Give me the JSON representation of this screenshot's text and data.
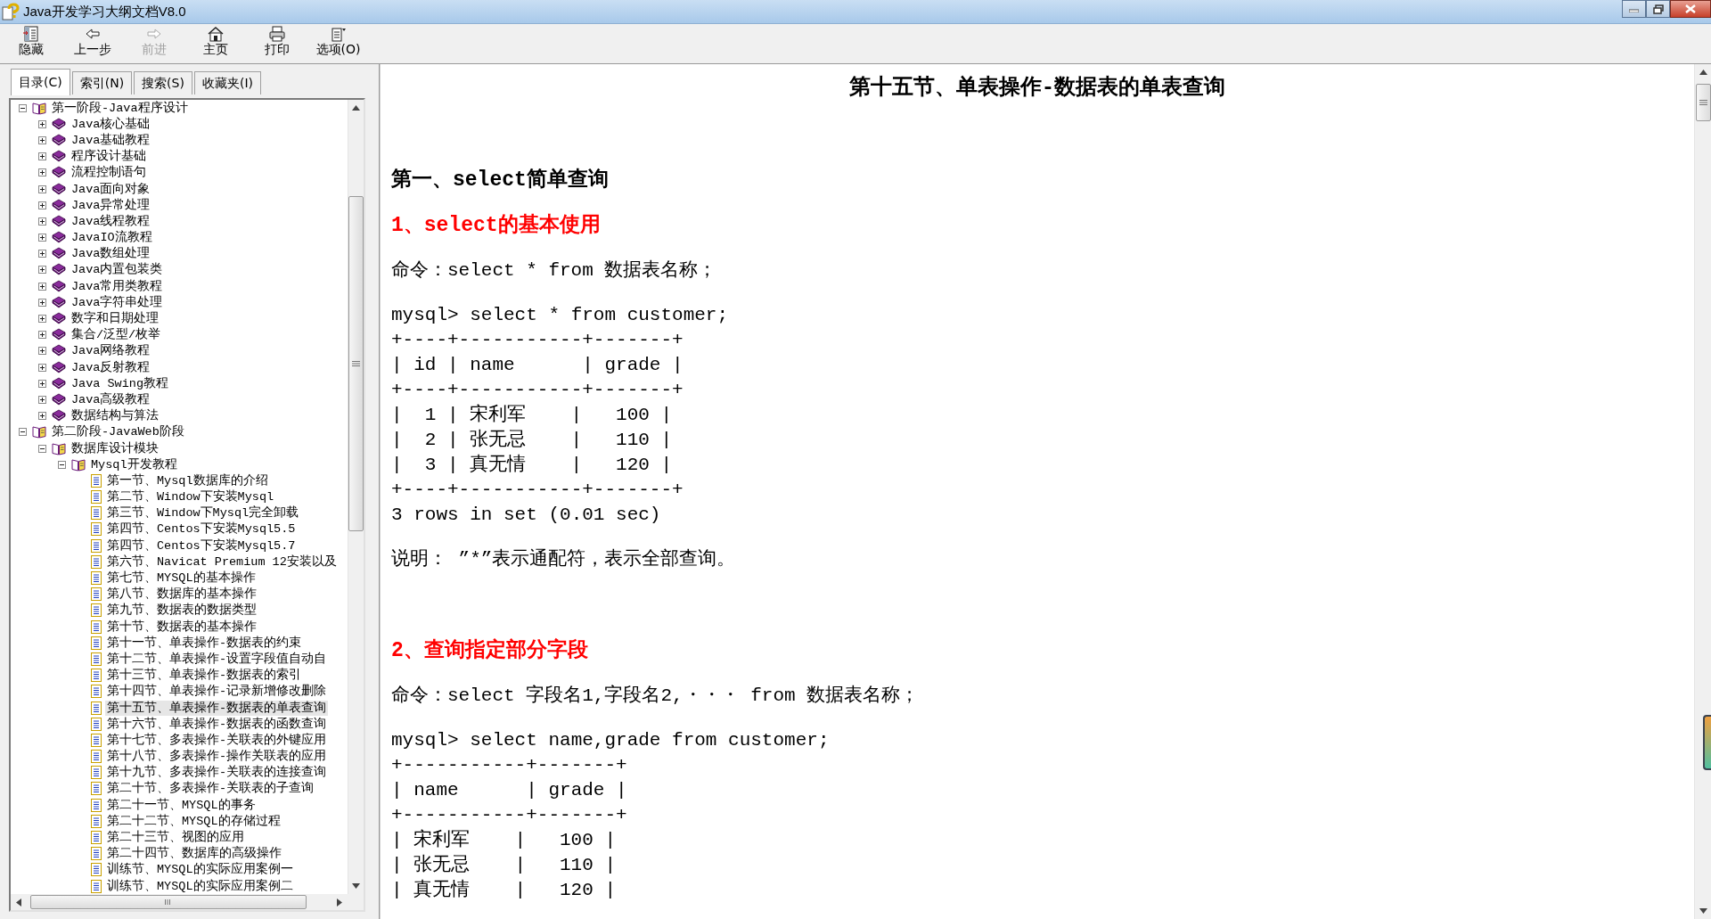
{
  "window": {
    "title": "Java开发学习大纲文档V8.0"
  },
  "toolbar": [
    {
      "kind": "hide",
      "label": "隐藏",
      "disabled": false
    },
    {
      "kind": "back",
      "label": "上一步",
      "disabled": false
    },
    {
      "kind": "forward",
      "label": "前进",
      "disabled": true
    },
    {
      "kind": "home",
      "label": "主页",
      "disabled": false
    },
    {
      "kind": "print",
      "label": "打印",
      "disabled": false
    },
    {
      "kind": "options",
      "label": "选项(O)",
      "disabled": false
    }
  ],
  "tabs": [
    {
      "label": "目录(C)",
      "selected": true
    },
    {
      "label": "索引(N)",
      "selected": false
    },
    {
      "label": "搜索(S)",
      "selected": false
    },
    {
      "label": "收藏夹(I)",
      "selected": false
    }
  ],
  "tree": [
    {
      "kind": "folder",
      "label": "第一阶段-Java程序设计",
      "expanded": true,
      "selected": false,
      "children": [
        {
          "kind": "folder",
          "label": "Java核心基础",
          "expanded": false,
          "selected": false
        },
        {
          "kind": "folder",
          "label": "Java基础教程",
          "expanded": false,
          "selected": false
        },
        {
          "kind": "folder",
          "label": "程序设计基础",
          "expanded": false,
          "selected": false
        },
        {
          "kind": "folder",
          "label": "流程控制语句",
          "expanded": false,
          "selected": false
        },
        {
          "kind": "folder",
          "label": "Java面向对象",
          "expanded": false,
          "selected": false
        },
        {
          "kind": "folder",
          "label": "Java异常处理",
          "expanded": false,
          "selected": false
        },
        {
          "kind": "folder",
          "label": "Java线程教程",
          "expanded": false,
          "selected": false
        },
        {
          "kind": "folder",
          "label": "JavaIO流教程",
          "expanded": false,
          "selected": false
        },
        {
          "kind": "folder",
          "label": "Java数组处理",
          "expanded": false,
          "selected": false
        },
        {
          "kind": "folder",
          "label": "Java内置包装类",
          "expanded": false,
          "selected": false
        },
        {
          "kind": "folder",
          "label": "Java常用类教程",
          "expanded": false,
          "selected": false
        },
        {
          "kind": "folder",
          "label": "Java字符串处理",
          "expanded": false,
          "selected": false
        },
        {
          "kind": "folder",
          "label": "数字和日期处理",
          "expanded": false,
          "selected": false
        },
        {
          "kind": "folder",
          "label": "集合/泛型/枚举",
          "expanded": false,
          "selected": false
        },
        {
          "kind": "folder",
          "label": "Java网络教程",
          "expanded": false,
          "selected": false
        },
        {
          "kind": "folder",
          "label": "Java反射教程",
          "expanded": false,
          "selected": false
        },
        {
          "kind": "folder",
          "label": "Java Swing教程",
          "expanded": false,
          "selected": false
        },
        {
          "kind": "folder",
          "label": "Java高级教程",
          "expanded": false,
          "selected": false
        },
        {
          "kind": "folder",
          "label": "数据结构与算法",
          "expanded": false,
          "selected": false
        }
      ]
    },
    {
      "kind": "folder",
      "label": "第二阶段-JavaWeb阶段",
      "expanded": true,
      "selected": false,
      "children": [
        {
          "kind": "folder",
          "label": "数据库设计模块",
          "expanded": true,
          "selected": false,
          "children": [
            {
              "kind": "folder",
              "label": "Mysql开发教程",
              "expanded": true,
              "selected": false,
              "children": [
                {
                  "kind": "page",
                  "label": "第一节、Mysql数据库的介绍",
                  "selected": false
                },
                {
                  "kind": "page",
                  "label": "第二节、Window下安装Mysql",
                  "selected": false
                },
                {
                  "kind": "page",
                  "label": "第三节、Window下Mysql完全卸载",
                  "selected": false
                },
                {
                  "kind": "page",
                  "label": "第四节、Centos下安装Mysql5.5",
                  "selected": false
                },
                {
                  "kind": "page",
                  "label": "第四节、Centos下安装Mysql5.7",
                  "selected": false
                },
                {
                  "kind": "page",
                  "label": "第六节、Navicat Premium 12安装以及",
                  "selected": false
                },
                {
                  "kind": "page",
                  "label": "第七节、MYSQL的基本操作",
                  "selected": false
                },
                {
                  "kind": "page",
                  "label": "第八节、数据库的基本操作",
                  "selected": false
                },
                {
                  "kind": "page",
                  "label": "第九节、数据表的数据类型",
                  "selected": false
                },
                {
                  "kind": "page",
                  "label": "第十节、数据表的基本操作",
                  "selected": false
                },
                {
                  "kind": "page",
                  "label": "第十一节、单表操作-数据表的约束",
                  "selected": false
                },
                {
                  "kind": "page",
                  "label": "第十二节、单表操作-设置字段值自动自",
                  "selected": false
                },
                {
                  "kind": "page",
                  "label": "第十三节、单表操作-数据表的索引",
                  "selected": false
                },
                {
                  "kind": "page",
                  "label": "第十四节、单表操作-记录新增修改删除",
                  "selected": false
                },
                {
                  "kind": "page",
                  "label": "第十五节、单表操作-数据表的单表查询",
                  "selected": true
                },
                {
                  "kind": "page",
                  "label": "第十六节、单表操作-数据表的函数查询",
                  "selected": false
                },
                {
                  "kind": "page",
                  "label": "第十七节、多表操作-关联表的外键应用",
                  "selected": false
                },
                {
                  "kind": "page",
                  "label": "第十八节、多表操作-操作关联表的应用",
                  "selected": false
                },
                {
                  "kind": "page",
                  "label": "第十九节、多表操作-关联表的连接查询",
                  "selected": false
                },
                {
                  "kind": "page",
                  "label": "第二十节、多表操作-关联表的子查询",
                  "selected": false
                },
                {
                  "kind": "page",
                  "label": "第二十一节、MYSQL的事务",
                  "selected": false
                },
                {
                  "kind": "page",
                  "label": "第二十二节、MYSQL的存储过程",
                  "selected": false
                },
                {
                  "kind": "page",
                  "label": "第二十三节、视图的应用",
                  "selected": false
                },
                {
                  "kind": "page",
                  "label": "第二十四节、数据库的高级操作",
                  "selected": false
                },
                {
                  "kind": "page",
                  "label": "训练节、MYSQL的实际应用案例一",
                  "selected": false
                },
                {
                  "kind": "page",
                  "label": "训练节、MYSQL的实际应用案例二",
                  "selected": false
                }
              ]
            }
          ]
        }
      ]
    }
  ],
  "content": {
    "title": "第十五节、单表操作-数据表的单表查询",
    "blocks": [
      {
        "kind": "h1",
        "text": "第一、select简单查询"
      },
      {
        "kind": "h2",
        "text": "1、select的基本使用"
      },
      {
        "kind": "p",
        "text": "命令：select * from 数据表名称；"
      },
      {
        "kind": "console",
        "lines": [
          "mysql> select * from customer;",
          "+----+-----------+-------+",
          "| id | name      | grade |",
          "+----+-----------+-------+",
          "|  1 | 宋利军    |   100 |",
          "|  2 | 张无忌    |   110 |",
          "|  3 | 真无情    |   120 |",
          "+----+-----------+-------+",
          "3 rows in set (0.01 sec)"
        ]
      },
      {
        "kind": "p",
        "text": "说明： ”*”表示通配符，表示全部查询。"
      },
      {
        "kind": "h2",
        "text": "2、查询指定部分字段"
      },
      {
        "kind": "p",
        "text": "命令：select 字段名1,字段名2,・・・ from 数据表名称；"
      },
      {
        "kind": "console",
        "lines": [
          "mysql> select name,grade from customer;",
          "+-----------+-------+",
          "| name      | grade |",
          "+-----------+-------+",
          "| 宋利军    |   100 |",
          "| 张无忌    |   110 |",
          "| 真无情    |   120 |"
        ]
      }
    ]
  }
}
